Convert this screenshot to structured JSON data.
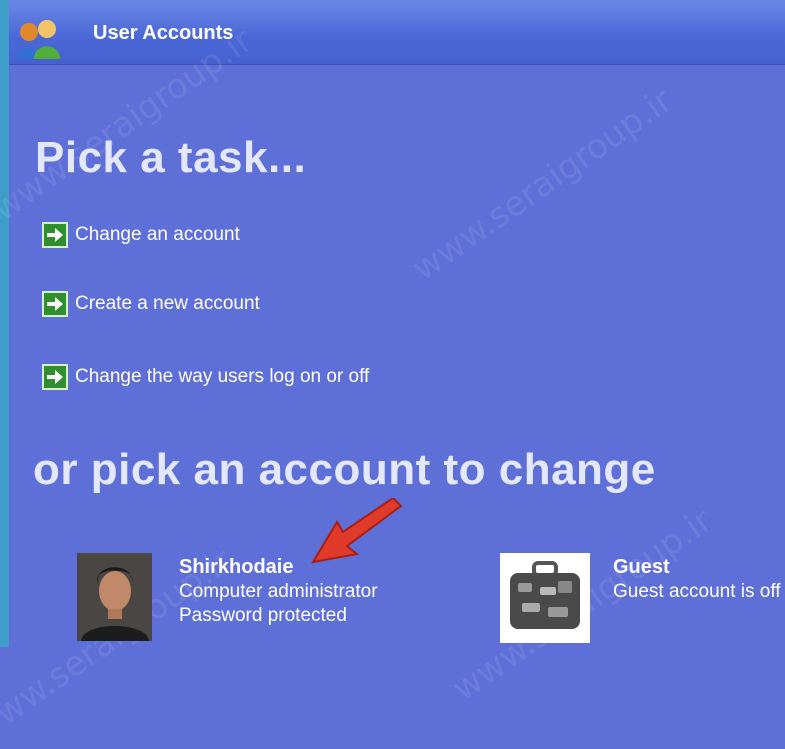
{
  "window": {
    "title": "User Accounts"
  },
  "heading_tasks": "Pick a task...",
  "tasks": [
    {
      "label": "Change an account"
    },
    {
      "label": "Create a new account"
    },
    {
      "label": "Change the way users log on or off"
    }
  ],
  "heading_accounts": "or pick an account to change",
  "accounts": [
    {
      "name": "Shirkhodaie",
      "line1": "Computer administrator",
      "line2": "Password protected"
    },
    {
      "name": "Guest",
      "line1": "Guest account is off"
    }
  ],
  "watermark": "www.seraigroup.ir",
  "colors": {
    "background": "#5f6fd8",
    "title_bar": "#4b67d6",
    "task_arrow": "#2f8f2f",
    "pointer_arrow": "#e03a2a"
  }
}
